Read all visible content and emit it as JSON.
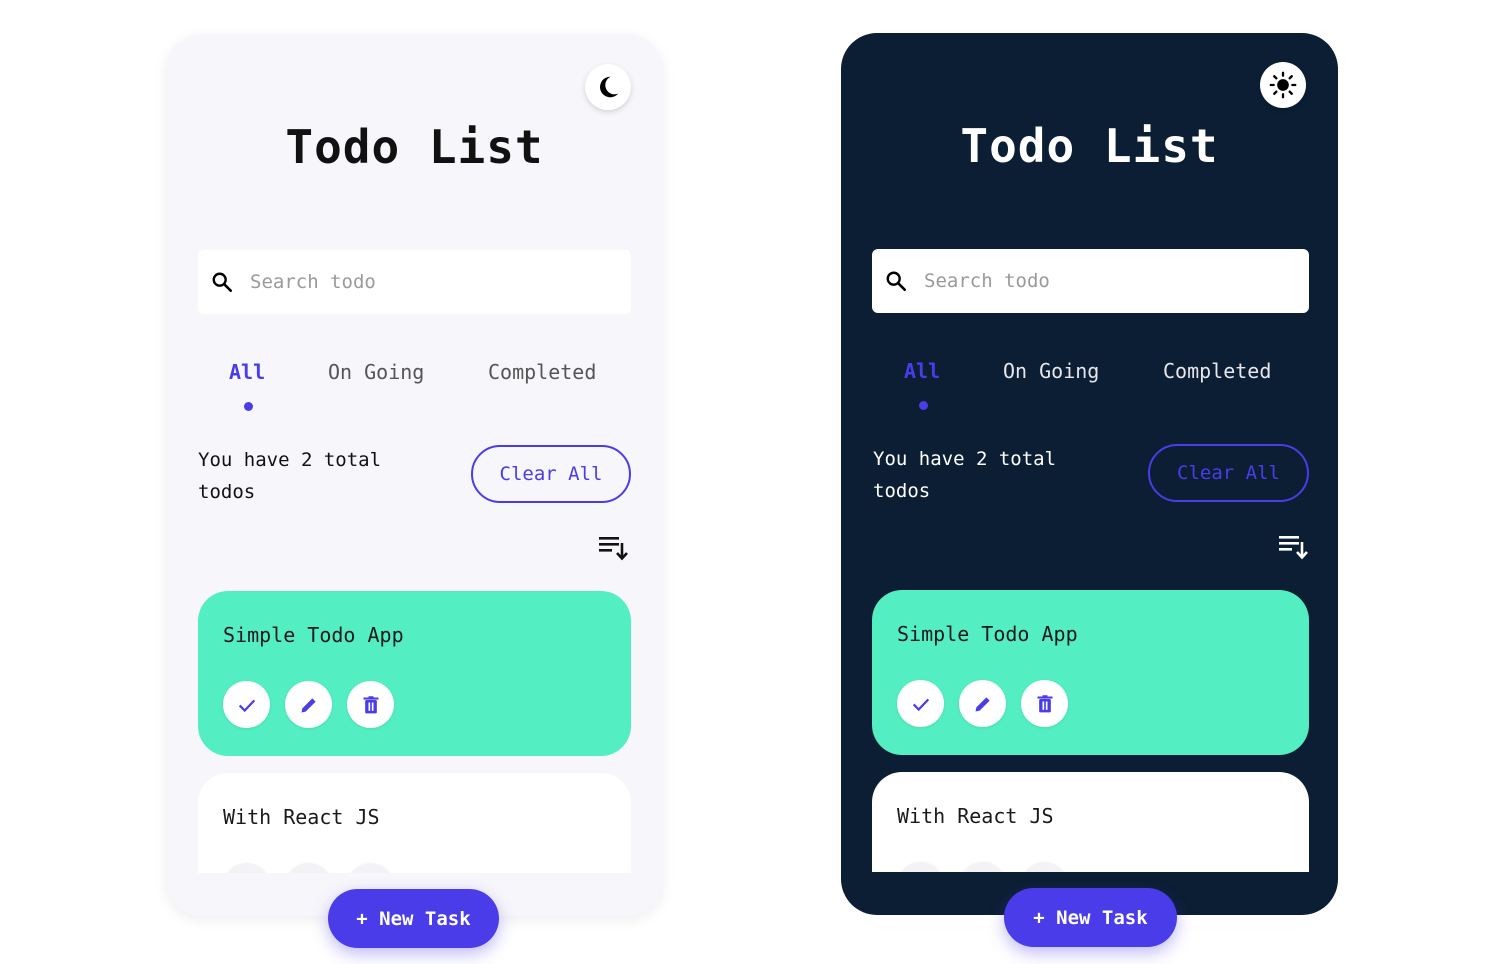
{
  "colors": {
    "accent": "#4a3ce8",
    "light_bg": "#f7f6fb",
    "dark_bg": "#0b1e33",
    "card_green": "#54eec3",
    "card_white": "#ffffff"
  },
  "light": {
    "theme_icon": "moon-icon",
    "title": "Todo List",
    "search": {
      "icon": "search-icon",
      "placeholder": "Search todo"
    },
    "tabs": [
      {
        "label": "All",
        "active": true
      },
      {
        "label": "On Going",
        "active": false
      },
      {
        "label": "Completed",
        "active": false
      }
    ],
    "summary_line1": "You have 2 total",
    "summary_line2": "todos",
    "clear_all": "Clear All",
    "sort_icon": "sort-descending-icon",
    "todos": [
      {
        "text": "Simple Todo App",
        "actions": [
          "check-icon",
          "pencil-icon",
          "trash-icon"
        ]
      },
      {
        "text": "With React JS",
        "actions": [
          "check-icon",
          "pencil-icon",
          "trash-icon"
        ]
      }
    ],
    "new_task": "+ New Task"
  },
  "dark": {
    "theme_icon": "sun-icon",
    "title": "Todo List",
    "search": {
      "icon": "search-icon",
      "placeholder": "Search todo"
    },
    "tabs": [
      {
        "label": "All",
        "active": true
      },
      {
        "label": "On Going",
        "active": false
      },
      {
        "label": "Completed",
        "active": false
      }
    ],
    "summary_line1": "You have 2 total",
    "summary_line2": "todos",
    "clear_all": "Clear All",
    "sort_icon": "sort-descending-icon",
    "todos": [
      {
        "text": "Simple Todo App",
        "actions": [
          "check-icon",
          "pencil-icon",
          "trash-icon"
        ]
      },
      {
        "text": "With React JS",
        "actions": [
          "check-icon",
          "pencil-icon",
          "trash-icon"
        ]
      }
    ],
    "new_task": "+ New Task"
  }
}
